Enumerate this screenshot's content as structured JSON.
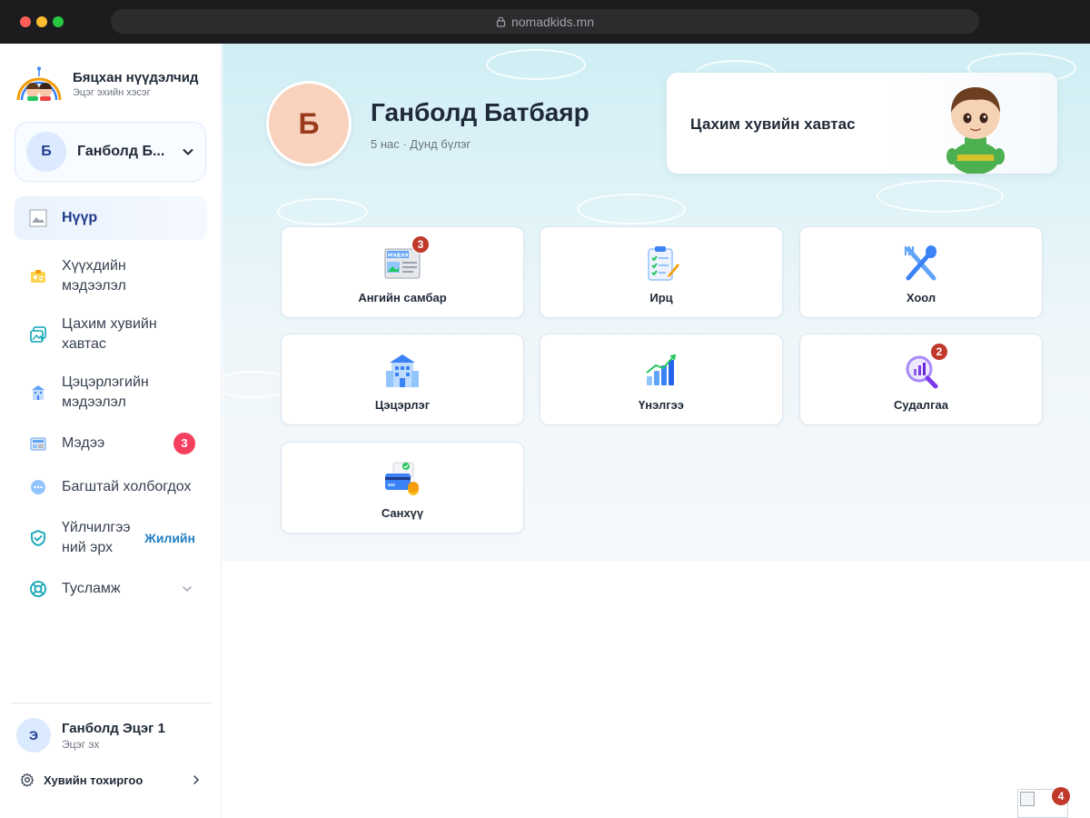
{
  "browser": {
    "url": "nomadkids.mn"
  },
  "brand": {
    "title": "Бяцхан нүүдэлчид",
    "subtitle": "Эцэг эхийн хэсэг"
  },
  "child_selector": {
    "initial": "Б",
    "name": "Ганболд Б..."
  },
  "nav": {
    "home": "Нүүр",
    "child_info": [
      "Хүүхдийн",
      "мэдээлэл"
    ],
    "portfolio": [
      "Цахим хувийн",
      "хавтас"
    ],
    "kindergarten_info": [
      "Цэцэрлэгийн",
      "мэдээлэл"
    ],
    "news": "Мэдээ",
    "news_badge": "3",
    "contact_teacher": "Багштай холбогдох",
    "service": [
      "Үйлчилгээ",
      "ний эрх"
    ],
    "service_plan": "Жилийн",
    "help": "Тусламж"
  },
  "parent": {
    "initial": "Э",
    "name": "Ганболд Эцэг 1",
    "role": "Эцэг эх"
  },
  "settings": {
    "label": "Хувийн тохиргоо"
  },
  "profile": {
    "initial": "Б",
    "name": "Ганболд Батбаяр",
    "meta": "5 нас · Дунд бүлэг"
  },
  "portfolio_card": {
    "title": "Цахим хувийн хавтас"
  },
  "tiles": {
    "board": {
      "label": "Ангийн самбар",
      "badge": "3",
      "icon_text": "МЭДЭЭ"
    },
    "attendance": {
      "label": "Ирц"
    },
    "food": {
      "label": "Хоол"
    },
    "kindergarten": {
      "label": "Цэцэрлэг"
    },
    "assessment": {
      "label": "Үнэлгээ"
    },
    "survey": {
      "label": "Судалгаа",
      "badge": "2"
    },
    "finance": {
      "label": "Санхүү"
    }
  },
  "floating": {
    "badge": "4"
  },
  "colors": {
    "accent": "#1e3a8a",
    "badge": "#f43f5e",
    "tile_badge": "#c0392b",
    "link": "#1d7ec2"
  }
}
